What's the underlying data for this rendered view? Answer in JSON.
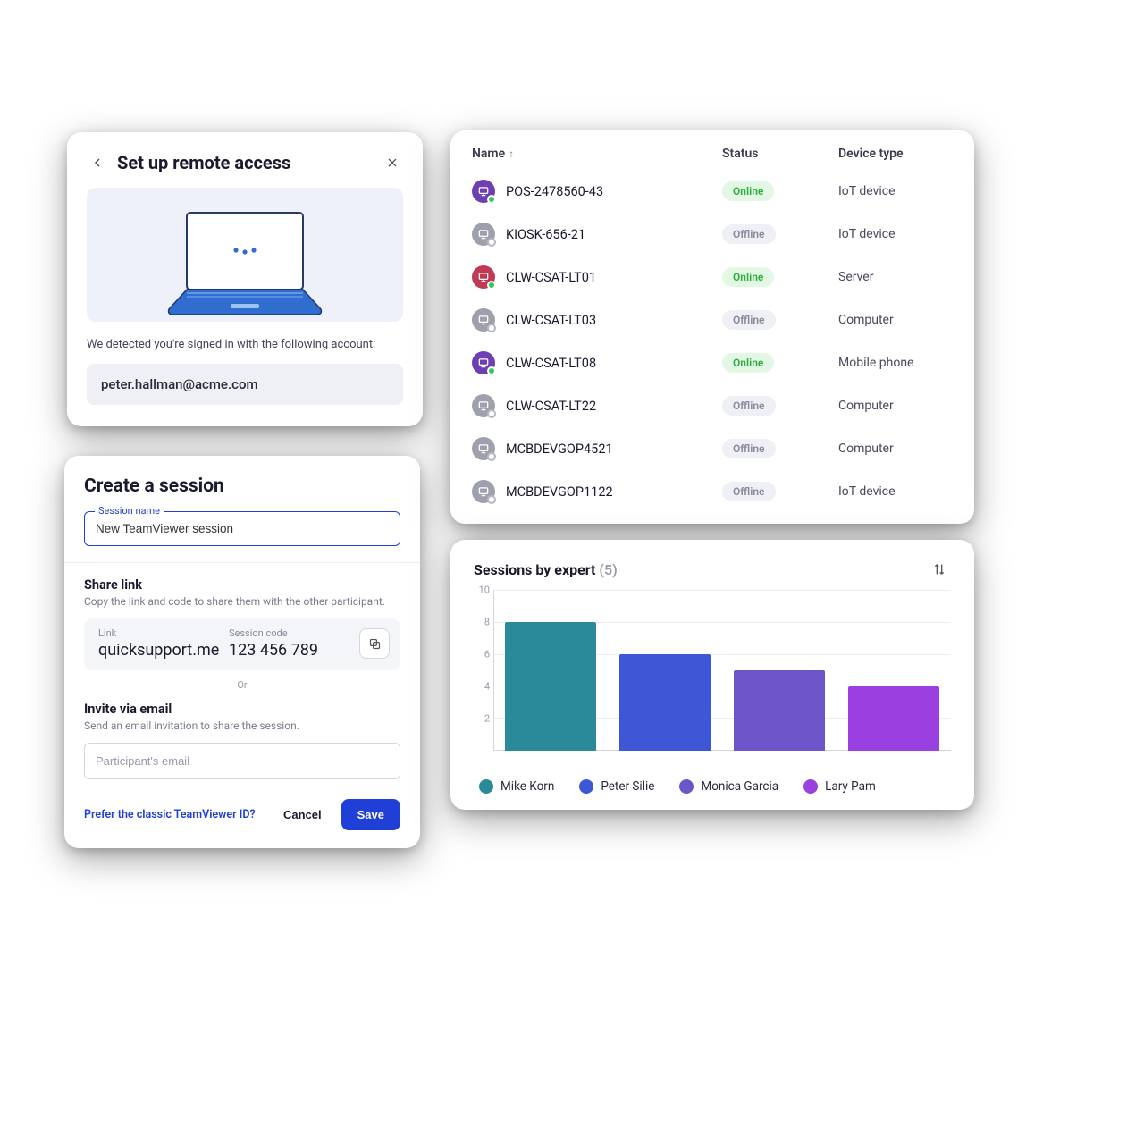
{
  "remote": {
    "title": "Set up remote access",
    "detected_msg": "We detected you're signed in with the following account:",
    "account": "peter.hallman@acme.com"
  },
  "session": {
    "title": "Create a session",
    "name_field_label": "Session name",
    "name_value": "New TeamViewer session",
    "share_title": "Share link",
    "share_desc": "Copy the link and code to share them with the other participant.",
    "link_label": "Link",
    "link_value": "quicksupport.me",
    "code_label": "Session code",
    "code_value": "123 456 789",
    "or": "Or",
    "invite_title": "Invite via email",
    "invite_desc": "Send an email invitation to share the session.",
    "email_placeholder": "Participant's email",
    "classic_link": "Prefer the classic TeamViewer ID?",
    "cancel": "Cancel",
    "save": "Save"
  },
  "table": {
    "columns": {
      "name": "Name",
      "status": "Status",
      "type": "Device type"
    },
    "rows": [
      {
        "name": "POS-2478560-43",
        "status": "Online",
        "type": "IoT device",
        "color": "purple"
      },
      {
        "name": "KIOSK-656-21",
        "status": "Offline",
        "type": "IoT device",
        "color": "gray"
      },
      {
        "name": "CLW-CSAT-LT01",
        "status": "Online",
        "type": "Server",
        "color": "red"
      },
      {
        "name": "CLW-CSAT-LT03",
        "status": "Offline",
        "type": "Computer",
        "color": "gray"
      },
      {
        "name": "CLW-CSAT-LT08",
        "status": "Online",
        "type": "Mobile phone",
        "color": "purple"
      },
      {
        "name": "CLW-CSAT-LT22",
        "status": "Offline",
        "type": "Computer",
        "color": "gray"
      },
      {
        "name": "MCBDEVGOP4521",
        "status": "Offline",
        "type": "Computer",
        "color": "gray"
      },
      {
        "name": "MCBDEVGOP1122",
        "status": "Offline",
        "type": "IoT device",
        "color": "gray"
      }
    ]
  },
  "chart_data": {
    "type": "bar",
    "title": "Sessions by expert",
    "count_label": "(5)",
    "categories": [
      "Mike Korn",
      "Peter Silie",
      "Monica Garcia",
      "Lary Pam"
    ],
    "values": [
      8,
      6,
      5,
      4
    ],
    "colors": [
      "#2b8a99",
      "#3d57d6",
      "#6b55c9",
      "#9a3fe0"
    ],
    "ylim": [
      0,
      10
    ],
    "yticks": [
      2,
      4,
      6,
      8,
      10
    ],
    "xlabel": "",
    "ylabel": ""
  }
}
